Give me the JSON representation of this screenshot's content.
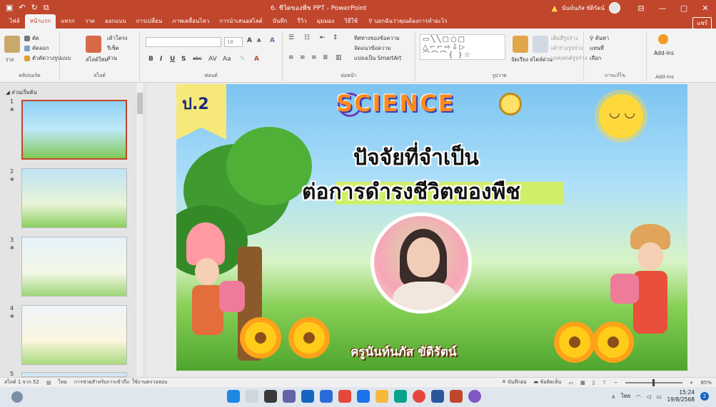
{
  "window": {
    "title": "6. ชีวิตของพืช PPT - PowerPoint",
    "user_name": "นันท์นภัส ขัติรัตน์",
    "share_label": "แชร์"
  },
  "tabs": [
    {
      "label": "ไฟล์"
    },
    {
      "label": "หน้าแรก"
    },
    {
      "label": "แทรก"
    },
    {
      "label": "วาด"
    },
    {
      "label": "ออกแบบ"
    },
    {
      "label": "การเปลี่ยน"
    },
    {
      "label": "ภาพเคลื่อนไหว"
    },
    {
      "label": "การนำเสนอสไลด์"
    },
    {
      "label": "บันทึก"
    },
    {
      "label": "รีวิว"
    },
    {
      "label": "มุมมอง"
    },
    {
      "label": "วิธีใช้"
    }
  ],
  "tell_me": "บอกฉันว่าคุณต้องการทำอะไร",
  "ribbon": {
    "clipboard": {
      "paste": "วาง",
      "cut": "ตัด",
      "copy": "คัดลอก",
      "format_painter": "ตัวคัดวางรูปแบบ",
      "label": "คลิปบอร์ด"
    },
    "slides": {
      "new_slide": "สไลด์ใหม่",
      "layout": "เค้าโครง",
      "reset": "รีเซ็ต",
      "section": "ส่วน",
      "label": "สไลด์"
    },
    "font": {
      "size": "18",
      "label": "ฟอนต์"
    },
    "paragraph": {
      "text_direction": "ทิศทางของข้อความ",
      "align_text": "จัดแนวข้อความ",
      "smartart": "แปลงเป็น SmartArt",
      "label": "ย่อหน้า"
    },
    "drawing": {
      "arrange": "จัดเรียง",
      "quick_styles": "สไตล์ด่วน",
      "shape_fill": "เติมสีรูปร่าง",
      "shape_outline": "เค้าร่างรูปร่าง",
      "shape_effects": "เอฟเฟกต์รูปร่าง",
      "label": "รูปวาด"
    },
    "editing": {
      "find": "ค้นหา",
      "replace": "แทนที่",
      "select": "เลือก",
      "label": "การแก้ไข"
    },
    "addins": {
      "label": "Add-ins",
      "button": "Add-ins"
    }
  },
  "pane": {
    "section_label": "ส่วนเริ่มต้น",
    "thumbnails": [
      {
        "number": "1",
        "selected": true
      },
      {
        "number": "2",
        "selected": false
      },
      {
        "number": "3",
        "selected": false
      },
      {
        "number": "4",
        "selected": false
      },
      {
        "number": "5",
        "selected": false
      }
    ]
  },
  "slide": {
    "grade": "ป.2",
    "science_word": "SCIENCE",
    "headline_line1": "ปัจจัยที่จำเป็น",
    "headline_line2": "ต่อการดำรงชีวิตของพืช",
    "teacher_name": "ครูนันท์นภัส ขัติรัตน์"
  },
  "statusbar": {
    "slide_count": "สไลด์ 1 จาก 52",
    "language": "ไทย",
    "accessibility": "การช่วยสำหรับการเข้าถึง: ใช้งานตรวจสอบ",
    "notes": "บันทึกย่อ",
    "comments": "ข้อคิดเห็น",
    "zoom": "85%"
  },
  "taskbar": {
    "language": "ไทย",
    "time": "15:24",
    "date": "19/8/2568",
    "notification_count": "2"
  },
  "colors": {
    "accent": "#c0462c",
    "ribbon_bg": "#f3f3f3",
    "highlight": "#d3f05a"
  }
}
